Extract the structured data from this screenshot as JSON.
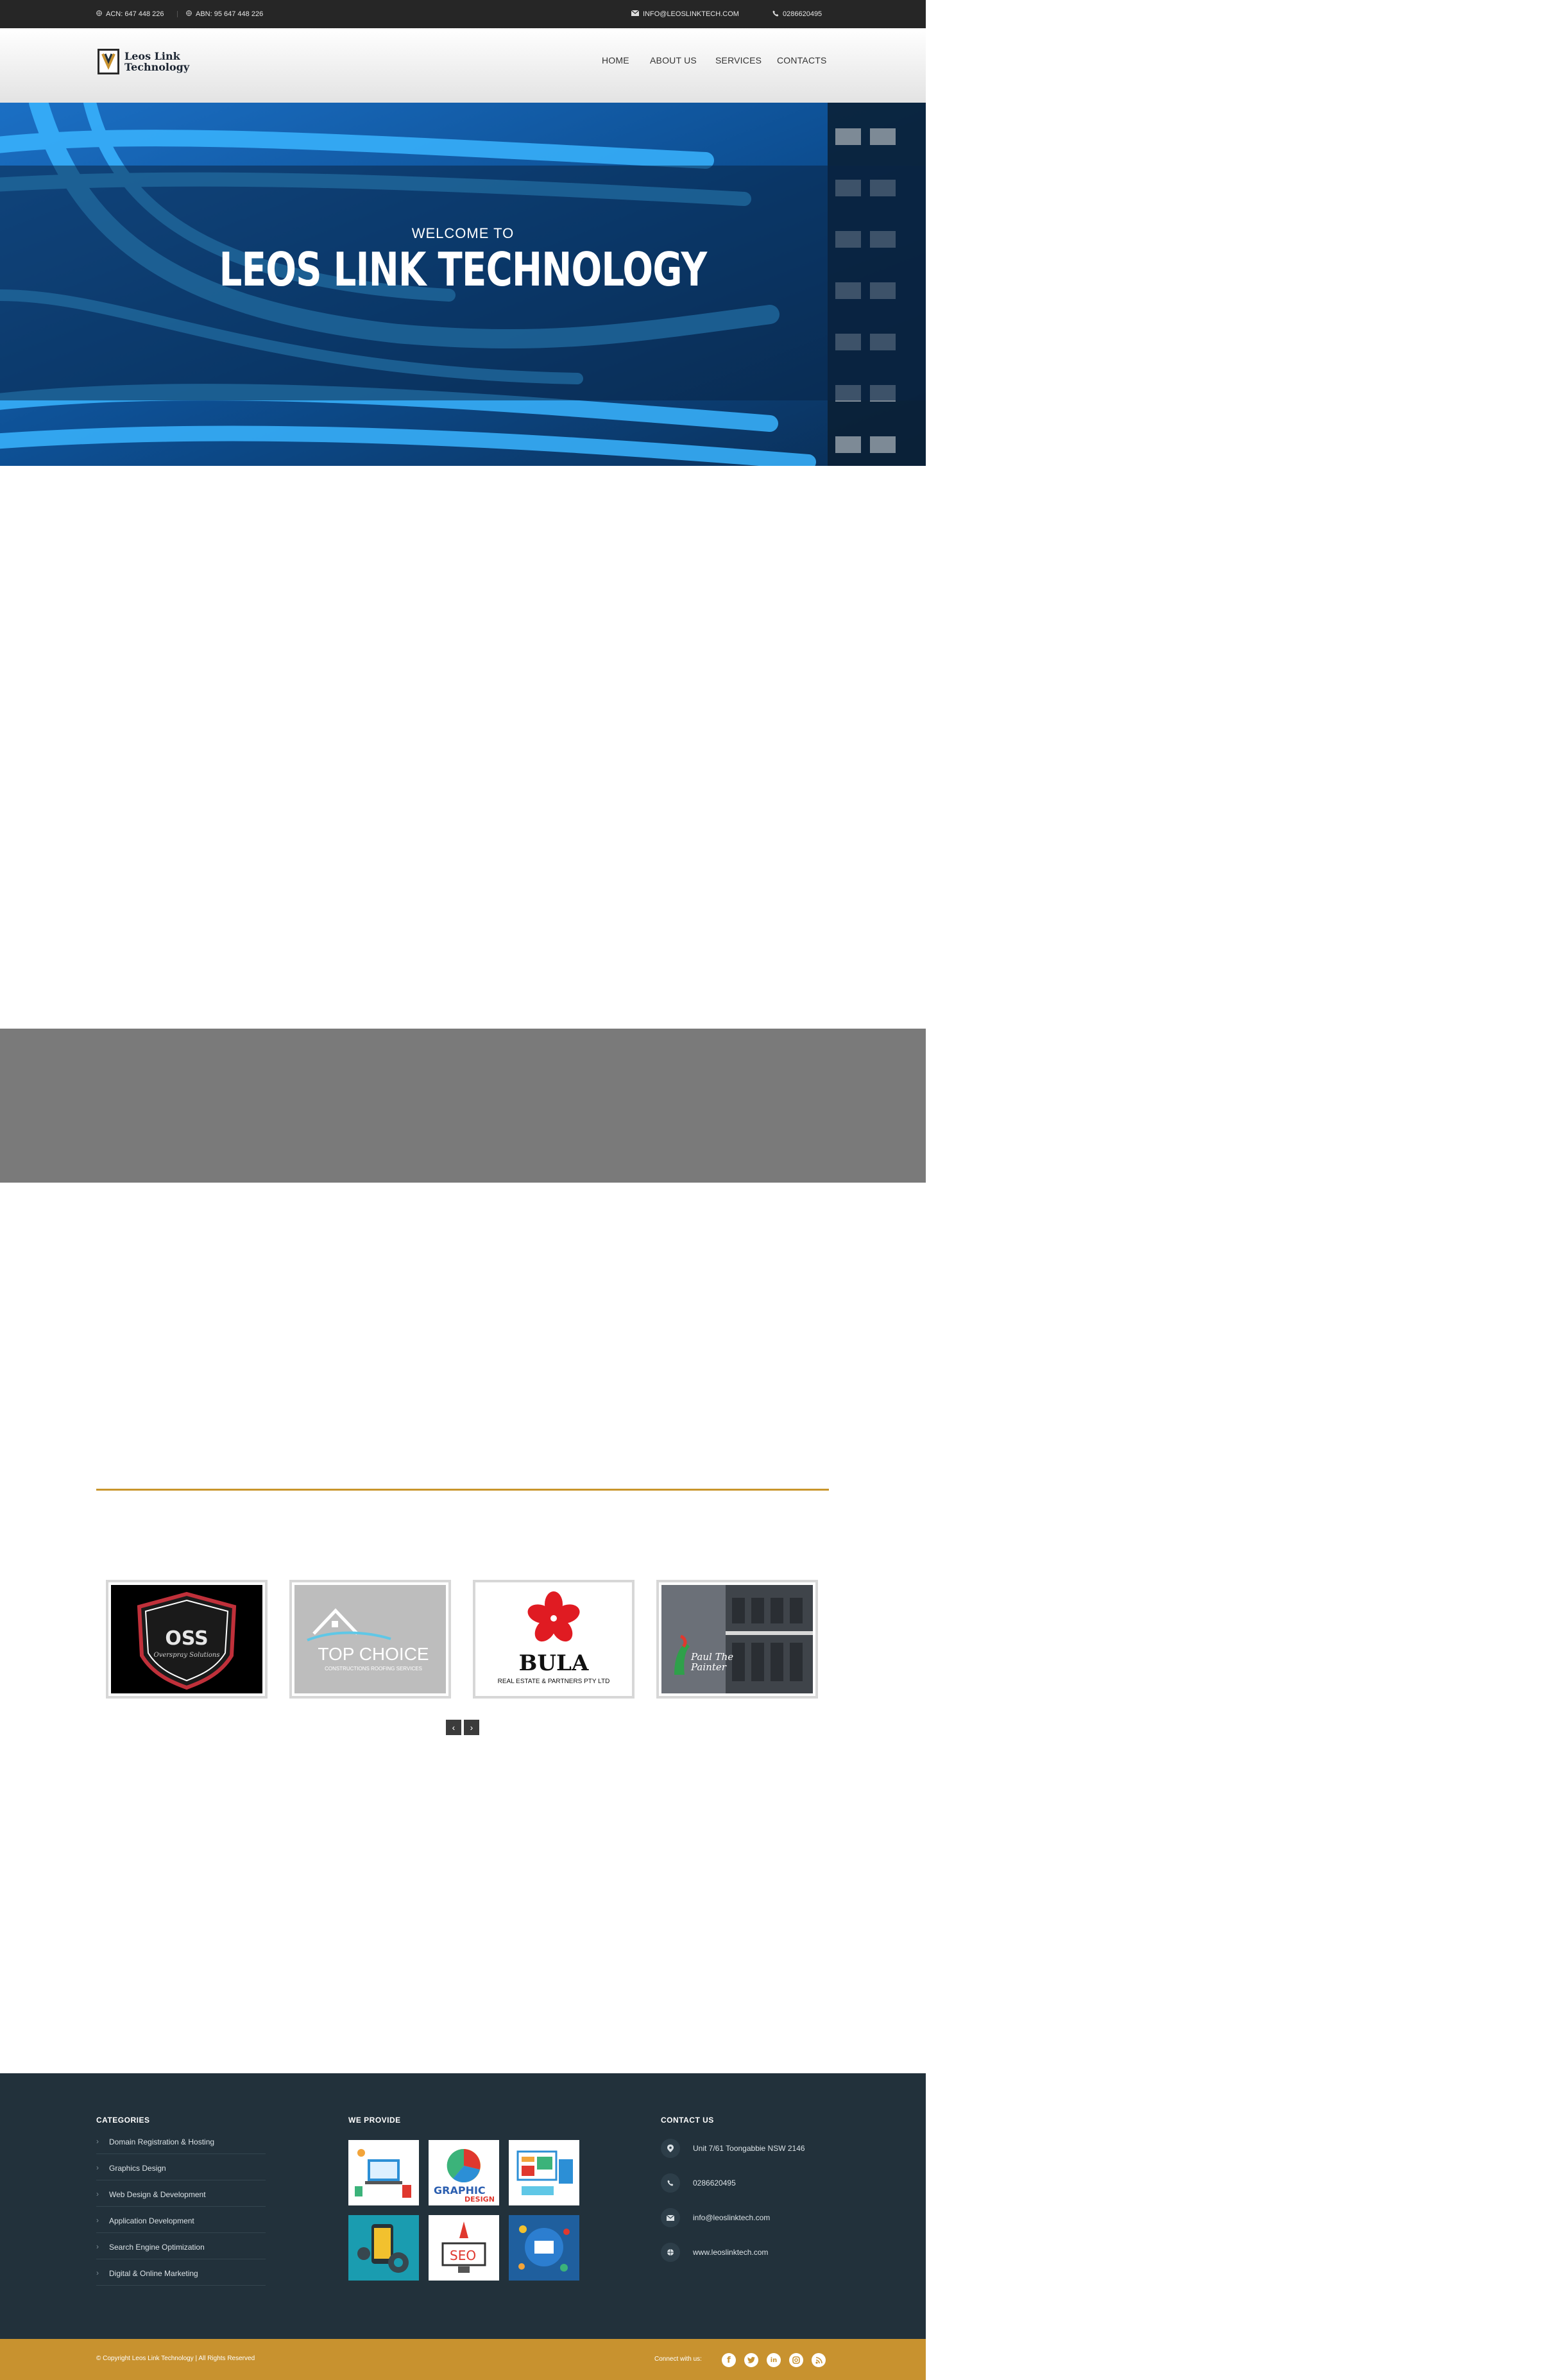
{
  "topbar": {
    "acn": "ACN: 647 448 226",
    "abn": "ABN: 95 647 448 226",
    "email": "INFO@LEOSLINKTECH.COM",
    "phone": "0286620495"
  },
  "header": {
    "logo_line1": "Leos Link",
    "logo_line2": "Technology",
    "nav": [
      "HOME",
      "ABOUT US",
      "SERVICES",
      "CONTACTS"
    ]
  },
  "hero": {
    "subtitle": "WELCOME TO",
    "title": "LEOS LINK TECHNOLOGY"
  },
  "clients": [
    {
      "name": "OSS",
      "tagline": "Overspray Solutions"
    },
    {
      "name": "TOP CHOICE",
      "tagline": "CONSTRUCTIONS ROOFING SERVICES"
    },
    {
      "name": "BULA",
      "tagline": "REAL ESTATE & PARTNERS PTY LTD"
    },
    {
      "name": "Paul The Painter",
      "tagline": ""
    }
  ],
  "carousel": {
    "prev": "‹",
    "next": "›"
  },
  "footer": {
    "categories_heading": "CATEGORIES",
    "categories": [
      "Domain Registration & Hosting",
      "Graphics Design",
      "Web Design & Development",
      "Application Development",
      "Search Engine Optimization",
      "Digital & Online Marketing"
    ],
    "provide_heading": "WE PROVIDE",
    "provide_labels": {
      "graphic": "GRAPHIC",
      "design": "DESIGN",
      "seo": "SEO"
    },
    "contact_heading": "CONTACT US",
    "contact": {
      "address": "Unit 7/61 Toongabbie NSW 2146",
      "phone": "0286620495",
      "email": "info@leoslinktech.com",
      "web": "www.leoslinktech.com"
    }
  },
  "bottom": {
    "copyright": "© Copyright Leos Link Technology  |  All Rights Reserved",
    "connect": "Connect with us:"
  },
  "colors": {
    "accent": "#c8922f",
    "footer_bg": "#22313b",
    "topbar_bg": "#262626",
    "hero_blue": "#1e90ff"
  }
}
